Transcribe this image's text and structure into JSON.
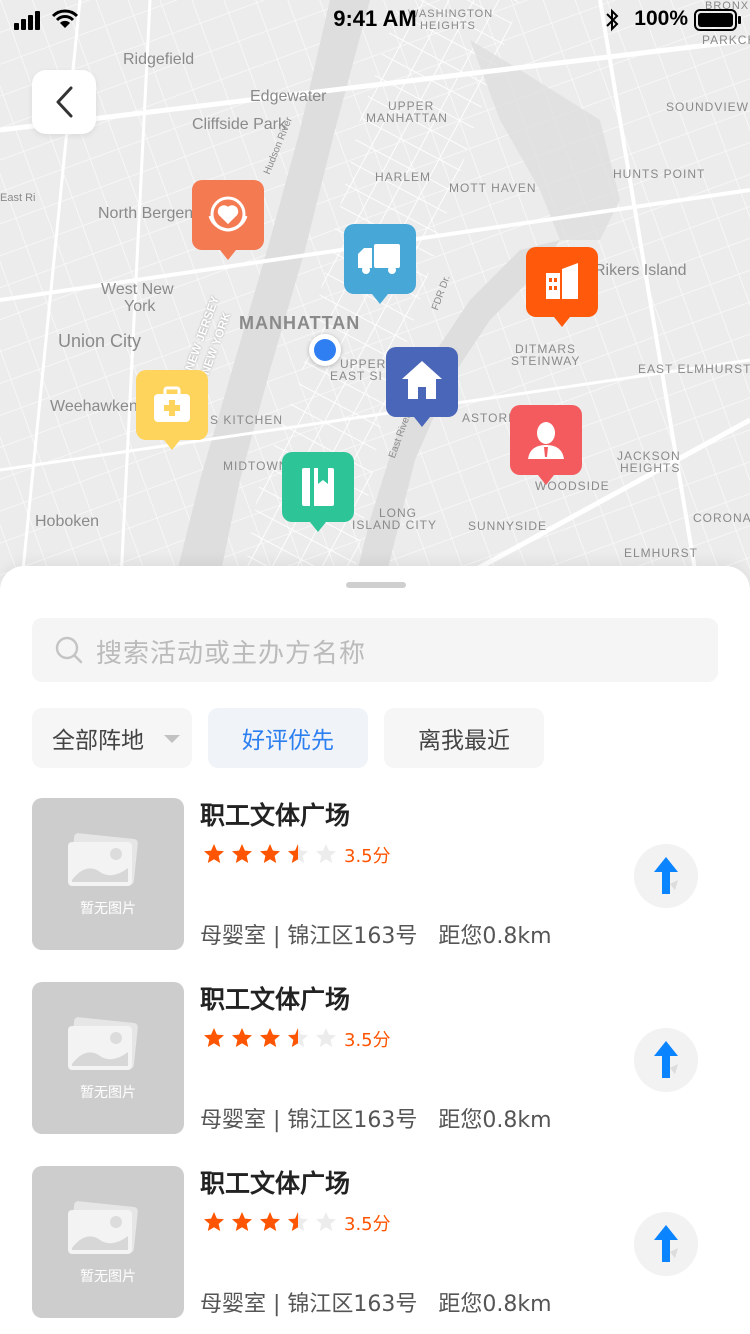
{
  "status_bar": {
    "time": "9:41 AM",
    "battery": "100%"
  },
  "map": {
    "labels": [
      "Ridgefield",
      "Edgewater",
      "Cliffside Park",
      "North Bergen",
      "West New",
      "York",
      "Union City",
      "Weehawken",
      "Hoboken",
      "MANHATTAN",
      "UPPER",
      "MANHATTAN",
      "HARLEM",
      "MOTT HAVEN",
      "HUNTS POINT",
      "SOUNDVIEW",
      "WASHINGTON",
      "HEIGHTS",
      "PARKCH",
      "BRONX",
      "Rikers Island",
      "DITMARS",
      "STEINWAY",
      "EAST ELMHURST",
      "ASTORIA",
      "WOODSIDE",
      "JACKSON",
      "HEIGHTS",
      "CORONA",
      "ELMHURST",
      "SUNNYSIDE",
      "LONG",
      "ISLAND CITY",
      "MIDTOWN",
      "S KITCHEN",
      "UPPER",
      "EAST SI",
      "Hudson River",
      "NEW JERSEY",
      "NEW YORK",
      "East Ri",
      "East River",
      "FDR Dr."
    ],
    "pins": [
      {
        "icon": "heart-hands-icon",
        "color": "#F47A52"
      },
      {
        "icon": "truck-icon",
        "color": "#47A8D8"
      },
      {
        "icon": "building-icon",
        "color": "#FF5A0C"
      },
      {
        "icon": "home-icon",
        "color": "#4A66B8"
      },
      {
        "icon": "medical-kit-icon",
        "color": "#FFD45C"
      },
      {
        "icon": "person-icon",
        "color": "#F45B5E"
      },
      {
        "icon": "book-icon",
        "color": "#2DC497"
      }
    ]
  },
  "search": {
    "placeholder": "搜索活动或主办方名称"
  },
  "filters": [
    {
      "label": "全部阵地",
      "has_dropdown": true,
      "active": false
    },
    {
      "label": "好评优先",
      "active": true
    },
    {
      "label": "离我最近",
      "active": false
    }
  ],
  "list": [
    {
      "name": "职工文体广场",
      "rating": 3.5,
      "score": "3.5分",
      "category": "母婴室",
      "address": "锦江区163号",
      "distance": "距您0.8km",
      "no_image": "暂无图片"
    },
    {
      "name": "职工文体广场",
      "rating": 3.5,
      "score": "3.5分",
      "category": "母婴室",
      "address": "锦江区163号",
      "distance": "距您0.8km",
      "no_image": "暂无图片"
    },
    {
      "name": "职工文体广场",
      "rating": 3.5,
      "score": "3.5分",
      "category": "母婴室",
      "address": "锦江区163号",
      "distance": "距您0.8km",
      "no_image": "暂无图片"
    }
  ],
  "colors": {
    "accent": "#2B7FF0",
    "star": "#FF5500",
    "nav_arrow": "#0A84FF"
  }
}
